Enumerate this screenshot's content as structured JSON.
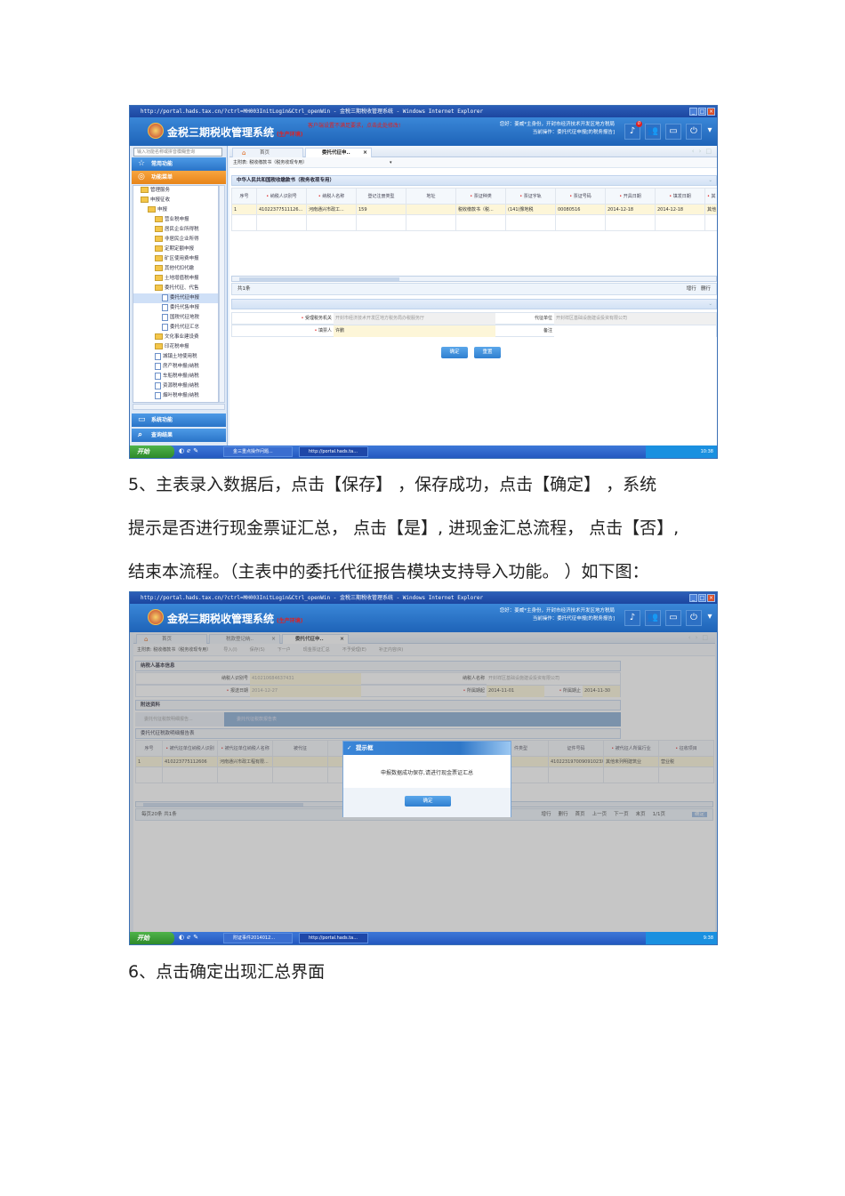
{
  "shot1": {
    "window_title": "http://portal.hads.tax.cn/?ctrl=MH003InitLogin&Ctrl_openWin - 金税三期税收管理系统 - Windows Internet Explorer",
    "app_title": "金税三期税收管理系统",
    "env_label": "(生产环境)",
    "red_notice": "客户端设置不满足要求，点击此处修改!",
    "user_line1": "您好：姜威*主身份，开封市经济技术开发区地方税局",
    "user_line2": "当前操作：委托代征申报[的税务报告]",
    "notif_count": "0",
    "search_placeholder": "输入功能名称或拼音模糊查询",
    "nav_common": "常用功能",
    "nav_menu": "功能菜单",
    "nav_system": "系统功能",
    "nav_query": "查询结果",
    "tree": [
      {
        "label": "管理服务",
        "type": "f",
        "indent": 1
      },
      {
        "label": "申报征收",
        "type": "f",
        "indent": 1
      },
      {
        "label": "申报",
        "type": "f",
        "indent": 2
      },
      {
        "label": "营业税申报",
        "type": "f",
        "indent": 3
      },
      {
        "label": "居民企业所得税",
        "type": "f",
        "indent": 3
      },
      {
        "label": "非居民企业所得",
        "type": "f",
        "indent": 3
      },
      {
        "label": "定期定额申报",
        "type": "f",
        "indent": 3
      },
      {
        "label": "矿区使用费申报",
        "type": "f",
        "indent": 3
      },
      {
        "label": "其他代扣代缴",
        "type": "f",
        "indent": 3
      },
      {
        "label": "土地增值税申报",
        "type": "f",
        "indent": 3
      },
      {
        "label": "委托代征、代售",
        "type": "f",
        "indent": 3
      },
      {
        "label": "委托代征申报",
        "type": "d",
        "indent": 4,
        "selected": true
      },
      {
        "label": "委托代售申报",
        "type": "d",
        "indent": 4
      },
      {
        "label": "国税代征地税",
        "type": "d",
        "indent": 4
      },
      {
        "label": "委托代征汇总",
        "type": "d",
        "indent": 4
      },
      {
        "label": "文化事业建设费",
        "type": "f",
        "indent": 3
      },
      {
        "label": "印花税申报",
        "type": "f",
        "indent": 3
      },
      {
        "label": "城镇土地使用税",
        "type": "d",
        "indent": 3
      },
      {
        "label": "房产税申报(纳税",
        "type": "d",
        "indent": 3
      },
      {
        "label": "车船税申报(纳税",
        "type": "d",
        "indent": 3
      },
      {
        "label": "资源税申报(纳税",
        "type": "d",
        "indent": 3
      },
      {
        "label": "烟叶税申报(纳税",
        "type": "d",
        "indent": 3
      }
    ],
    "tab_home": "首页",
    "tab_active": "委托代征申..",
    "toolbar_label": "主附表:",
    "toolbar_select": "税收缴款书（税务收现专用）",
    "section_title": "中华人民共和国税收缴款书（税务收现专用）",
    "columns": [
      "序号",
      "纳税人识别号",
      "纳税人名称",
      "登记注册类型",
      "地址",
      "票证种类",
      "票证字轨",
      "票证号码",
      "开具日期",
      "填发日期",
      "其"
    ],
    "required_cols": [
      1,
      2,
      5,
      6,
      7,
      8,
      9,
      10
    ],
    "rows": [
      [
        "1",
        "41022377511126...",
        "河南通兴市政工...",
        "159",
        "",
        "税收缴款书（税...",
        "(141)豫地税",
        "00080516",
        "2014-12-18",
        "2014-12-18",
        "其他"
      ]
    ],
    "footer_count": "共1条",
    "add_row": "增行",
    "del_row": "删行",
    "form": {
      "tax_office_label": "受理税务机关",
      "tax_office_value": "开封市经济技术开发区地方税务局办税服务厅",
      "agent_label": "代征单位",
      "agent_value": "开封祥区基础设施建设投资有限公司",
      "filler_label": "填票人",
      "filler_value": "许鹏",
      "remark_label": "备注",
      "remark_value": ""
    },
    "confirm_btn": "确定",
    "reset_btn": "重置",
    "taskbar": {
      "start": "开始",
      "item1": "金三重点操作问题...",
      "item2": "http://portal.hads.ta...",
      "clock": "10:38"
    }
  },
  "paragraph5_line1": "5、主表录入数据后，点击【保存】 ，保存成功，点击【确定】 ，系统",
  "paragraph5_line2": "提示是否进行现金票证汇总，  点击【是】, 进现金汇总流程，  点击【否】,",
  "paragraph5_line3": "结束本流程。（主表中的委托代征报告模块支持导入功能。    ）如下图：",
  "shot2": {
    "tab_home": "首页",
    "tab2": "税款登记纳..",
    "tab_active": "委托代征申..",
    "toolbar_select": "主附表: 税收缴款书（税务收现专用）",
    "tools": [
      "导入(I)",
      "保存(S)",
      "下一户",
      "现金票证汇总",
      "不予受理(E)",
      "补正内容(R)"
    ],
    "sec_basic": "纳税人基本信息",
    "taxpayer_id_label": "纳税人识别号",
    "taxpayer_id": "410210684637431",
    "taxpayer_name_label": "纳税人名称",
    "taxpayer_name": "开封祥区基础设施建设投资有限公司",
    "report_date_label": "报送日期",
    "report_date": "2014-12-27",
    "period_start_label": "所属期起",
    "period_start": "2014-11-01",
    "period_end_label": "所属期止",
    "period_end": "2014-11-30",
    "sec_attach": "附送资料",
    "subtab1": "委托代征税款明细报告...",
    "subtab2": "委托代征税款报告表",
    "sec_detail": "委托代征税款明细报告表",
    "columns": [
      "序号",
      "被代征单位纳税人识别",
      "被代征单位纳税人名称",
      "被代征",
      "",
      "",
      "",
      "件类型",
      "证件号码",
      "被代征人所属行业",
      "征收项目"
    ],
    "rows": [
      [
        "1",
        "410223775112606",
        "河南通兴市政工程有限...",
        "",
        "",
        "",
        "",
        "证",
        "410223197009091023X",
        "其他未列明建筑业",
        "营业税"
      ]
    ],
    "footer_left": "每页20条 共1条",
    "pager": [
      "增行",
      "删行",
      "首页",
      "上一页",
      "下一页",
      "末页",
      "1/1页"
    ],
    "go": "确定",
    "dialog_title": "提示框",
    "dialog_msg": "申报数据成功保存,请进行现金票证汇总",
    "dialog_ok": "确定",
    "taskbar": {
      "start": "开始",
      "item1": "附证事件2014012...",
      "item2": "http://portal.hads.ta...",
      "clock": "9:38"
    }
  },
  "paragraph6": "6、点击确定出现汇总界面"
}
